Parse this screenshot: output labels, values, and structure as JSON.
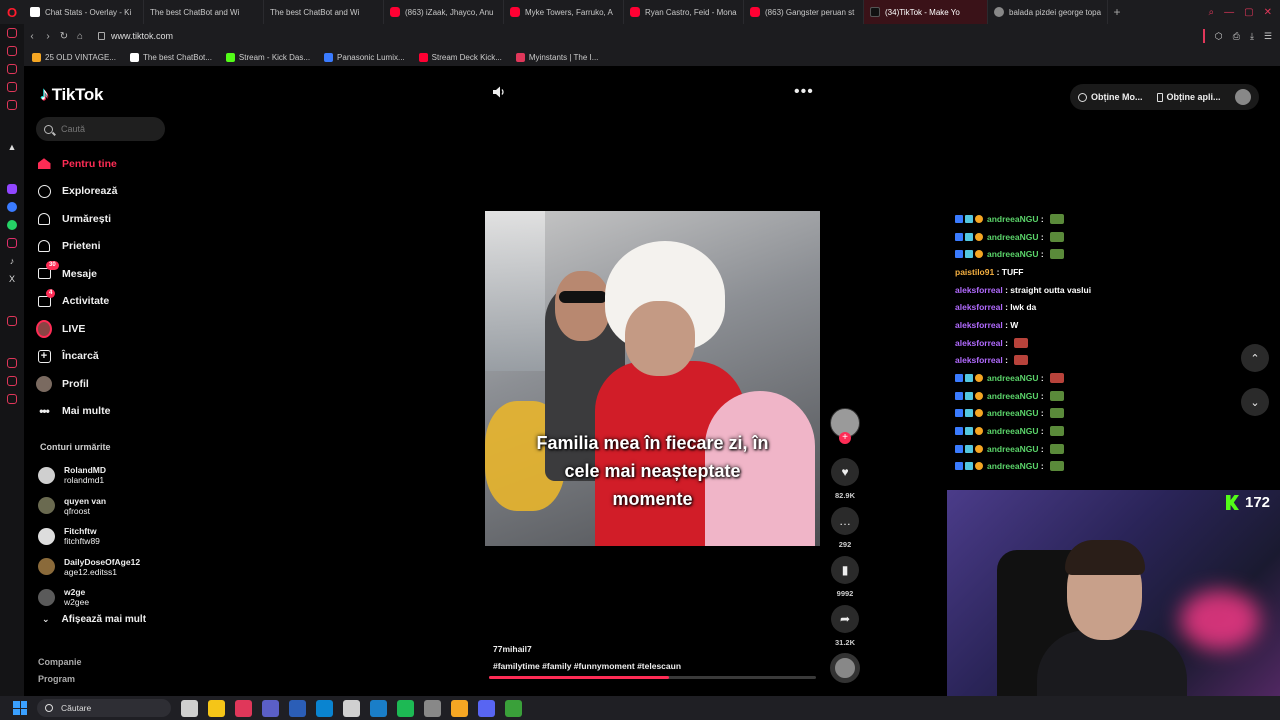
{
  "browser": {
    "tabs": [
      {
        "title": "Chat Stats - Overlay - Ki",
        "fav": "grid"
      },
      {
        "title": "The best ChatBot and Wi",
        "fav": "chat"
      },
      {
        "title": "The best ChatBot and Wi",
        "fav": "chat"
      },
      {
        "title": "(863) iZaak, Jhayco, Anu",
        "fav": "yt"
      },
      {
        "title": "Myke Towers, Farruko, A",
        "fav": "yt"
      },
      {
        "title": "Ryan Castro, Feid - Mona",
        "fav": "yt"
      },
      {
        "title": "(863) Gangster peruan st",
        "fav": "yt"
      },
      {
        "title": "(34)TikTok - Make Yo",
        "fav": "tt",
        "active": true
      },
      {
        "title": "balada pizdei george topa",
        "fav": "glob"
      }
    ],
    "new_tab": "+",
    "url": "www.tiktok.com",
    "bookmarks": [
      {
        "label": "25 OLD VINTAGE...",
        "color": "#f5a623"
      },
      {
        "label": "The best ChatBot...",
        "color": "#ffffff"
      },
      {
        "label": "Stream - Kick Das...",
        "color": "#53fc18"
      },
      {
        "label": "Panasonic Lumix...",
        "color": "#3a7bff"
      },
      {
        "label": "Stream Deck Kick...",
        "color": "#ff0033"
      },
      {
        "label": "Myinstants | The I...",
        "color": "#e0375a"
      }
    ]
  },
  "tiktok": {
    "logo": "TikTok",
    "search_placeholder": "Caută",
    "nav": [
      {
        "label": "Pentru tine",
        "icon": "home-icon",
        "active": true
      },
      {
        "label": "Explorează",
        "icon": "compass-icon"
      },
      {
        "label": "Urmărești",
        "icon": "following-icon"
      },
      {
        "label": "Prieteni",
        "icon": "friends-icon"
      },
      {
        "label": "Mesaje",
        "icon": "messages-icon",
        "badge": "30"
      },
      {
        "label": "Activitate",
        "icon": "activity-icon",
        "badge": "4"
      },
      {
        "label": "LIVE",
        "icon": "live-icon"
      },
      {
        "label": "Încarcă",
        "icon": "upload-icon"
      },
      {
        "label": "Profil",
        "icon": "profile-icon"
      },
      {
        "label": "Mai multe",
        "icon": "more-icon"
      }
    ],
    "following_title": "Conturi urmărite",
    "following": [
      {
        "name": "RolandMD",
        "handle": "rolandmd1",
        "color": "#cfcfcf"
      },
      {
        "name": "quyen van",
        "handle": "qfroost",
        "color": "#6a6a50"
      },
      {
        "name": "Fitchftw",
        "handle": "fitchftw89",
        "color": "#ddd"
      },
      {
        "name": "DailyDoseOfAge12",
        "handle": "age12.editss1",
        "color": "#8a6a3a"
      },
      {
        "name": "w2ge",
        "handle": "w2gee",
        "color": "#5a5a5a"
      }
    ],
    "show_more": "Afișează mai mult",
    "footer": [
      "Companie",
      "Program"
    ],
    "top_right": {
      "coins": "Obține Mo...",
      "app": "Obține apli..."
    },
    "video": {
      "caption_lines": [
        "Familia mea în fiecare zi, în",
        "cele mai neașteptate",
        "momente"
      ],
      "author": "77mihail7",
      "hashtags": "#familytime  #family  #funnymoment  #telescaun",
      "progress": 0.55
    },
    "actions": {
      "likes": "82.9K",
      "comments": "292",
      "saves": "9992",
      "shares": "31.2K"
    }
  },
  "stream": {
    "chat": [
      {
        "user": "andreeaNGU",
        "badges": true,
        "msg": "",
        "emote": "frog",
        "color": "#5bd46a"
      },
      {
        "user": "andreeaNGU",
        "badges": true,
        "msg": "",
        "emote": "frog",
        "color": "#5bd46a"
      },
      {
        "user": "andreeaNGU",
        "badges": true,
        "msg": "",
        "emote": "frog",
        "color": "#5bd46a"
      },
      {
        "user": "paistilo91",
        "badges": false,
        "msg": "TUFF",
        "emote": "",
        "color": "#f5b041"
      },
      {
        "user": "aleksforreal",
        "badges": false,
        "msg": "straight outta vaslui",
        "emote": "",
        "color": "#b26bff"
      },
      {
        "user": "aleksforreal",
        "badges": false,
        "msg": "lwk da",
        "emote": "",
        "color": "#b26bff"
      },
      {
        "user": "aleksforreal",
        "badges": false,
        "msg": "W",
        "emote": "",
        "color": "#b26bff"
      },
      {
        "user": "aleksforreal",
        "badges": false,
        "msg": "",
        "emote": "red",
        "color": "#b26bff"
      },
      {
        "user": "aleksforreal",
        "badges": false,
        "msg": "",
        "emote": "red",
        "color": "#b26bff"
      },
      {
        "user": "andreeaNGU",
        "badges": true,
        "msg": "",
        "emote": "red",
        "color": "#5bd46a"
      },
      {
        "user": "andreeaNGU",
        "badges": true,
        "msg": "",
        "emote": "frog",
        "color": "#5bd46a"
      },
      {
        "user": "andreeaNGU",
        "badges": true,
        "msg": "",
        "emote": "frog",
        "color": "#5bd46a"
      },
      {
        "user": "andreeaNGU",
        "badges": true,
        "msg": "",
        "emote": "frog",
        "color": "#5bd46a"
      },
      {
        "user": "andreeaNGU",
        "badges": true,
        "msg": "",
        "emote": "frog",
        "color": "#5bd46a"
      },
      {
        "user": "andreeaNGU",
        "badges": true,
        "msg": "",
        "emote": "frog",
        "color": "#5bd46a"
      }
    ],
    "viewers": "172"
  },
  "taskbar": {
    "search": "Căutare",
    "apps": [
      "#cfcfcf",
      "#f5c518",
      "#e0375a",
      "#5b5fc7",
      "#2b5eb7",
      "#0a84d0",
      "#d0d0d0",
      "#1a7ec8",
      "#1db954",
      "#888",
      "#f5a623",
      "#5865f2",
      "#3aa03a"
    ]
  }
}
